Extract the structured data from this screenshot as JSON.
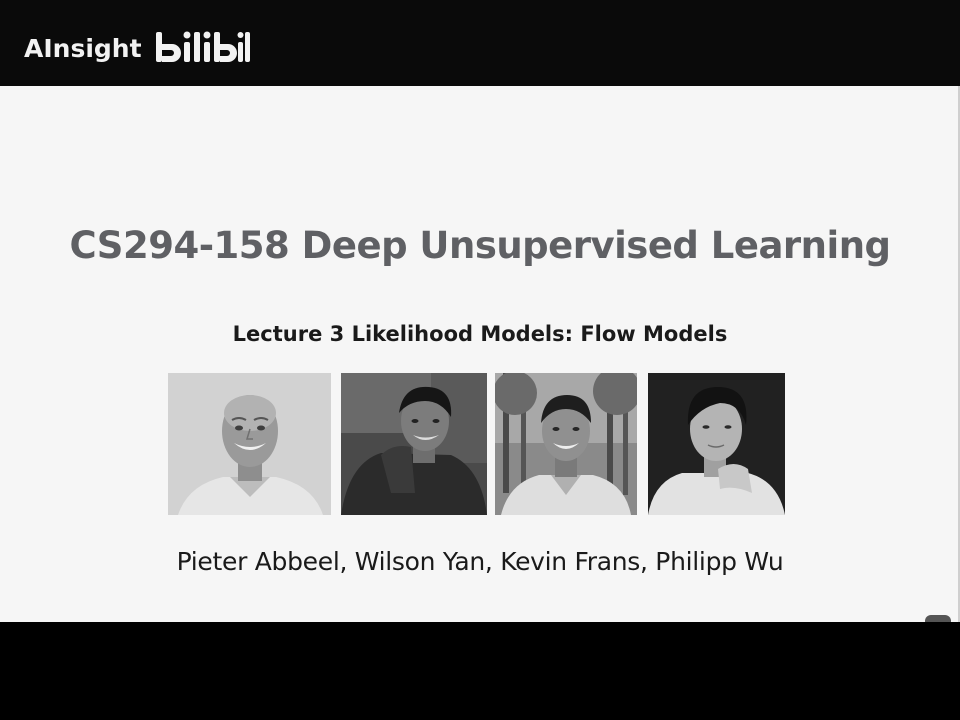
{
  "watermark": {
    "channel": "AInsight",
    "platform_logo_text": "bilibili"
  },
  "slide": {
    "title": "CS294-158 Deep Unsupervised Learning",
    "subtitle": "Lecture 3 Likelihood Models: Flow Models",
    "authors": "Pieter Abbeel, Wilson Yan, Kevin Frans, Philipp Wu"
  },
  "photos": [
    {
      "icon": "portrait-photo",
      "tone": "light-background"
    },
    {
      "icon": "portrait-photo",
      "tone": "dark-background"
    },
    {
      "icon": "portrait-photo",
      "tone": "outdoor-trees"
    },
    {
      "icon": "portrait-photo",
      "tone": "dark-background"
    }
  ],
  "colors": {
    "title": "#5f6064",
    "text": "#1a1a1a",
    "slide_background": "#f6f6f6",
    "letterbox": "#000000"
  }
}
